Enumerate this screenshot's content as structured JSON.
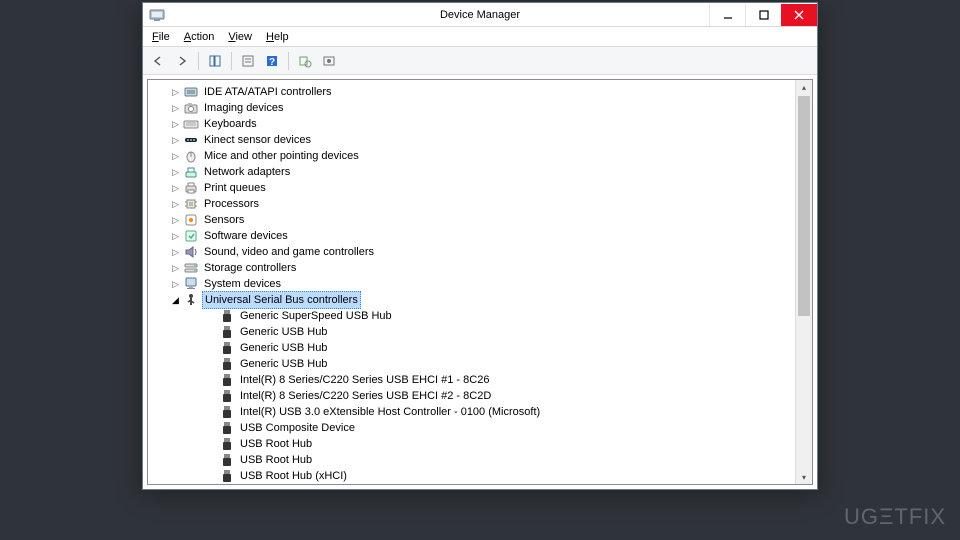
{
  "window": {
    "title": "Device Manager"
  },
  "menu": {
    "file": "File",
    "action": "Action",
    "view": "View",
    "help": "Help"
  },
  "tree": {
    "categories": [
      {
        "label": "IDE ATA/ATAPI controllers",
        "icon": "ide"
      },
      {
        "label": "Imaging devices",
        "icon": "camera"
      },
      {
        "label": "Keyboards",
        "icon": "keyboard"
      },
      {
        "label": "Kinect sensor devices",
        "icon": "kinect"
      },
      {
        "label": "Mice and other pointing devices",
        "icon": "mouse"
      },
      {
        "label": "Network adapters",
        "icon": "network"
      },
      {
        "label": "Print queues",
        "icon": "printer"
      },
      {
        "label": "Processors",
        "icon": "cpu"
      },
      {
        "label": "Sensors",
        "icon": "sensor"
      },
      {
        "label": "Software devices",
        "icon": "software"
      },
      {
        "label": "Sound, video and game controllers",
        "icon": "sound"
      },
      {
        "label": "Storage controllers",
        "icon": "storage"
      },
      {
        "label": "System devices",
        "icon": "system"
      }
    ],
    "usb_category": {
      "label": "Universal Serial Bus controllers"
    },
    "usb_children": [
      {
        "label": "Generic SuperSpeed USB Hub"
      },
      {
        "label": "Generic USB Hub"
      },
      {
        "label": "Generic USB Hub"
      },
      {
        "label": "Generic USB Hub"
      },
      {
        "label": "Intel(R) 8 Series/C220 Series USB EHCI #1 - 8C26"
      },
      {
        "label": "Intel(R) 8 Series/C220 Series USB EHCI #2 - 8C2D"
      },
      {
        "label": "Intel(R) USB 3.0 eXtensible Host Controller - 0100 (Microsoft)"
      },
      {
        "label": "USB Composite Device"
      },
      {
        "label": "USB Root Hub"
      },
      {
        "label": "USB Root Hub"
      },
      {
        "label": "USB Root Hub (xHCI)"
      }
    ]
  },
  "watermark": "UGΞTFIX"
}
